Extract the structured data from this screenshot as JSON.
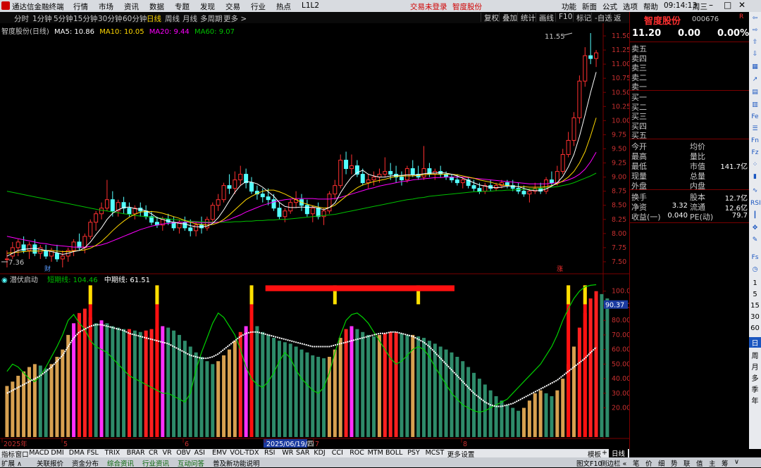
{
  "app_title": "通达信金融终端",
  "menu": [
    "行情",
    "市场",
    "资讯",
    "数据",
    "专题",
    "发现",
    "交易",
    "行业",
    "热点",
    "L1L2"
  ],
  "menu_red": [
    "交易未登录",
    "智度股份"
  ],
  "menu_right": [
    "功能",
    "新面",
    "公式",
    "选项",
    "帮助"
  ],
  "clock": "09:14:13",
  "weekday": "周三",
  "periods": [
    "分时",
    "1分钟",
    "5分钟",
    "15分钟",
    "30分钟",
    "60分钟",
    "日线",
    "周线",
    "月线",
    "多周期",
    "更多 >"
  ],
  "active_period": "日线",
  "toolbar_right": [
    "复权",
    "叠加",
    "统计",
    "画线",
    "F10",
    "标记",
    "-自选",
    "返回"
  ],
  "main_legend": {
    "name": "智度股份(日线)",
    "ma5": "MA5: 10.86",
    "ma10": "MA10: 10.05",
    "ma20": "MA20: 9.44",
    "ma60": "MA60: 9.07"
  },
  "sub_legend": {
    "name": "潜伏启动",
    "line1": "短期线: 104.46",
    "line2": "中期线: 61.51"
  },
  "price_axis": [
    "11.50",
    "11.25",
    "11.00",
    "10.75",
    "10.50",
    "10.25",
    "10.00",
    "9.75",
    "9.50",
    "9.25",
    "9.00",
    "8.75",
    "8.50",
    "8.25",
    "8.00",
    "7.75",
    "7.50"
  ],
  "sub_axis": [
    "100.0",
    "90.00",
    "80.00",
    "70.00",
    "60.00",
    "50.00",
    "40.00",
    "30.00",
    "20.00"
  ],
  "sub_current": "90.37",
  "price_high_label": "11.55",
  "price_low_label": "7.36",
  "event_marks": [
    "财",
    "涨"
  ],
  "date_axis": [
    "2025年",
    "5",
    "6",
    "2025/06/19/四",
    "7",
    "8"
  ],
  "period_label": "日线",
  "colors": {
    "up": "#ff3030",
    "down": "#54ffff",
    "ma5": "#ffffff",
    "ma10": "#ffd700",
    "ma20": "#ff00ff",
    "ma60": "#00c000"
  },
  "chart_data": {
    "type": "candlestick",
    "ylim": [
      7.3,
      11.6
    ],
    "candles": [
      [
        7.55,
        7.7,
        7.4,
        7.55
      ],
      [
        7.6,
        7.85,
        7.55,
        7.75
      ],
      [
        7.75,
        7.9,
        7.6,
        7.85
      ],
      [
        7.8,
        7.95,
        7.65,
        7.7
      ],
      [
        7.7,
        7.85,
        7.55,
        7.8
      ],
      [
        7.8,
        7.9,
        7.6,
        7.65
      ],
      [
        7.65,
        7.8,
        7.55,
        7.75
      ],
      [
        7.7,
        7.8,
        7.55,
        7.6
      ],
      [
        7.6,
        7.75,
        7.5,
        7.7
      ],
      [
        7.65,
        7.8,
        7.5,
        7.55
      ],
      [
        7.55,
        7.7,
        7.4,
        7.6
      ],
      [
        7.6,
        7.75,
        7.5,
        7.7
      ],
      [
        7.7,
        7.9,
        7.6,
        7.85
      ],
      [
        7.85,
        8.0,
        7.7,
        7.75
      ],
      [
        7.75,
        8.0,
        7.65,
        7.95
      ],
      [
        7.95,
        8.25,
        7.9,
        8.2
      ],
      [
        8.2,
        8.4,
        8.05,
        8.35
      ],
      [
        8.35,
        8.55,
        8.25,
        8.45
      ],
      [
        8.45,
        8.95,
        8.4,
        8.6
      ],
      [
        8.6,
        8.75,
        8.3,
        8.4
      ],
      [
        8.4,
        8.6,
        8.3,
        8.55
      ],
      [
        8.55,
        8.65,
        8.35,
        8.45
      ],
      [
        8.45,
        8.55,
        8.3,
        8.35
      ],
      [
        8.35,
        8.5,
        8.25,
        8.45
      ],
      [
        8.45,
        8.55,
        8.3,
        8.4
      ],
      [
        8.4,
        8.5,
        8.25,
        8.3
      ],
      [
        8.3,
        8.4,
        8.15,
        8.2
      ],
      [
        8.2,
        8.3,
        8.1,
        8.15
      ],
      [
        8.15,
        8.3,
        8.05,
        8.25
      ],
      [
        8.25,
        8.35,
        8.15,
        8.2
      ],
      [
        8.2,
        8.3,
        8.05,
        8.1
      ],
      [
        8.1,
        8.25,
        8.0,
        8.2
      ],
      [
        8.2,
        8.3,
        8.05,
        8.1
      ],
      [
        8.1,
        8.25,
        7.95,
        8.05
      ],
      [
        8.05,
        8.2,
        7.95,
        8.15
      ],
      [
        8.15,
        8.3,
        8.0,
        8.1
      ],
      [
        8.1,
        8.3,
        8.05,
        8.25
      ],
      [
        8.25,
        8.55,
        8.2,
        8.5
      ],
      [
        8.5,
        8.7,
        8.4,
        8.6
      ],
      [
        8.6,
        8.9,
        8.55,
        8.85
      ],
      [
        8.85,
        9.05,
        8.7,
        8.8
      ],
      [
        8.8,
        9.1,
        8.7,
        8.95
      ],
      [
        8.95,
        9.2,
        8.85,
        9.05
      ],
      [
        9.05,
        9.15,
        8.8,
        8.9
      ],
      [
        8.9,
        9.0,
        8.7,
        8.75
      ],
      [
        8.75,
        8.85,
        8.6,
        8.7
      ],
      [
        8.7,
        8.8,
        8.55,
        8.65
      ],
      [
        8.65,
        8.8,
        8.5,
        8.6
      ],
      [
        8.6,
        8.7,
        8.4,
        8.45
      ],
      [
        8.45,
        8.55,
        8.25,
        8.3
      ],
      [
        8.3,
        8.45,
        8.2,
        8.4
      ],
      [
        8.4,
        8.6,
        8.35,
        8.55
      ],
      [
        8.55,
        8.75,
        8.45,
        8.6
      ],
      [
        8.6,
        8.7,
        8.4,
        8.5
      ],
      [
        8.5,
        8.6,
        8.3,
        8.35
      ],
      [
        8.35,
        8.5,
        8.2,
        8.45
      ],
      [
        8.45,
        8.55,
        8.25,
        8.3
      ],
      [
        8.3,
        8.45,
        8.15,
        8.4
      ],
      [
        8.4,
        8.75,
        8.35,
        8.7
      ],
      [
        8.7,
        8.95,
        8.6,
        8.85
      ],
      [
        8.85,
        9.4,
        8.8,
        9.3
      ],
      [
        9.3,
        9.45,
        9.05,
        9.15
      ],
      [
        9.15,
        9.4,
        9.05,
        9.2
      ],
      [
        9.2,
        9.3,
        9.0,
        9.05
      ],
      [
        9.05,
        9.15,
        8.85,
        8.9
      ],
      [
        8.9,
        9.05,
        8.8,
        8.95
      ],
      [
        8.95,
        9.1,
        8.85,
        9.0
      ],
      [
        9.0,
        9.15,
        8.9,
        9.05
      ],
      [
        9.05,
        9.35,
        9.0,
        9.1
      ],
      [
        9.1,
        9.25,
        8.95,
        9.05
      ],
      [
        9.05,
        9.2,
        8.9,
        9.0
      ],
      [
        9.0,
        9.1,
        8.85,
        8.95
      ],
      [
        8.95,
        9.2,
        8.9,
        9.15
      ],
      [
        9.15,
        9.3,
        9.0,
        9.05
      ],
      [
        9.05,
        9.2,
        8.95,
        9.0
      ],
      [
        9.0,
        9.55,
        8.95,
        9.15
      ],
      [
        9.15,
        9.25,
        9.0,
        9.05
      ],
      [
        9.05,
        9.15,
        8.95,
        9.1
      ],
      [
        9.1,
        9.2,
        9.0,
        9.05
      ],
      [
        9.05,
        9.1,
        8.95,
        9.0
      ],
      [
        9.0,
        9.05,
        8.9,
        8.95
      ],
      [
        8.95,
        9.05,
        8.85,
        8.9
      ],
      [
        8.9,
        9.0,
        8.8,
        8.95
      ],
      [
        8.95,
        9.0,
        8.8,
        8.85
      ],
      [
        8.85,
        8.95,
        8.75,
        8.8
      ],
      [
        8.8,
        8.9,
        8.7,
        8.75
      ],
      [
        8.75,
        8.9,
        8.7,
        8.85
      ],
      [
        8.85,
        8.95,
        8.75,
        8.8
      ],
      [
        8.8,
        8.9,
        8.75,
        8.85
      ],
      [
        8.85,
        8.95,
        8.8,
        8.9
      ],
      [
        8.9,
        8.95,
        8.8,
        8.85
      ],
      [
        8.85,
        8.95,
        8.75,
        8.8
      ],
      [
        8.8,
        8.9,
        8.7,
        8.75
      ],
      [
        8.75,
        8.85,
        8.65,
        8.7
      ],
      [
        8.7,
        8.8,
        8.55,
        8.75
      ],
      [
        8.75,
        8.9,
        8.7,
        8.8
      ],
      [
        8.8,
        8.9,
        8.7,
        8.75
      ],
      [
        8.75,
        9.0,
        8.7,
        8.95
      ],
      [
        8.95,
        9.1,
        8.85,
        8.9
      ],
      [
        8.9,
        9.2,
        8.85,
        9.1
      ],
      [
        9.1,
        9.5,
        9.05,
        9.4
      ],
      [
        9.4,
        9.8,
        9.35,
        9.65
      ],
      [
        9.65,
        10.15,
        9.55,
        10.05
      ],
      [
        10.05,
        10.8,
        9.95,
        10.7
      ],
      [
        10.7,
        11.3,
        10.6,
        11.15
      ],
      [
        11.15,
        11.55,
        11.0,
        11.1
      ],
      [
        11.1,
        11.25,
        10.95,
        11.2
      ]
    ],
    "ma5": [
      7.6,
      7.65,
      7.7,
      7.72,
      7.73,
      7.74,
      7.72,
      7.7,
      7.68,
      7.66,
      7.63,
      7.65,
      7.68,
      7.7,
      7.75,
      7.85,
      7.98,
      8.1,
      8.25,
      8.36,
      8.42,
      8.46,
      8.47,
      8.44,
      8.43,
      8.4,
      8.35,
      8.28,
      8.25,
      8.22,
      8.2,
      8.18,
      8.17,
      8.14,
      8.12,
      8.12,
      8.13,
      8.18,
      8.28,
      8.42,
      8.58,
      8.73,
      8.85,
      8.92,
      8.91,
      8.88,
      8.82,
      8.74,
      8.66,
      8.55,
      8.48,
      8.46,
      8.46,
      8.47,
      8.46,
      8.47,
      8.45,
      8.42,
      8.46,
      8.54,
      8.72,
      8.87,
      9.0,
      9.08,
      9.12,
      9.05,
      9.02,
      9.0,
      9.0,
      9.02,
      9.03,
      9.03,
      9.04,
      9.04,
      9.04,
      9.06,
      9.07,
      9.07,
      9.08,
      9.07,
      9.05,
      9.02,
      8.98,
      8.94,
      8.9,
      8.86,
      8.84,
      8.82,
      8.81,
      8.82,
      8.84,
      8.84,
      8.83,
      8.8,
      8.77,
      8.76,
      8.76,
      8.79,
      8.84,
      8.9,
      9.01,
      9.18,
      9.4,
      9.72,
      10.1,
      10.5,
      10.86
    ],
    "ma10": [
      7.65,
      7.66,
      7.67,
      7.68,
      7.69,
      7.69,
      7.69,
      7.7,
      7.7,
      7.69,
      7.68,
      7.68,
      7.69,
      7.7,
      7.71,
      7.74,
      7.79,
      7.86,
      7.95,
      8.05,
      8.14,
      8.22,
      8.29,
      8.34,
      8.38,
      8.39,
      8.39,
      8.38,
      8.36,
      8.33,
      8.3,
      8.27,
      8.23,
      8.2,
      8.17,
      8.16,
      8.15,
      8.16,
      8.19,
      8.25,
      8.33,
      8.42,
      8.51,
      8.6,
      8.66,
      8.71,
      8.75,
      8.77,
      8.77,
      8.74,
      8.7,
      8.65,
      8.6,
      8.55,
      8.52,
      8.49,
      8.47,
      8.45,
      8.46,
      8.5,
      8.58,
      8.66,
      8.74,
      8.81,
      8.86,
      8.89,
      8.92,
      8.94,
      8.96,
      8.99,
      9.01,
      9.02,
      9.02,
      9.02,
      9.03,
      9.04,
      9.05,
      9.05,
      9.05,
      9.05,
      9.05,
      9.04,
      9.02,
      9.0,
      8.98,
      8.95,
      8.93,
      8.91,
      8.88,
      8.86,
      8.85,
      8.84,
      8.83,
      8.83,
      8.82,
      8.82,
      8.82,
      8.83,
      8.85,
      8.88,
      8.93,
      9.0,
      9.1,
      9.25,
      9.45,
      9.73,
      10.05
    ],
    "ma20": [
      7.95,
      7.93,
      7.91,
      7.89,
      7.87,
      7.85,
      7.83,
      7.82,
      7.8,
      7.79,
      7.78,
      7.77,
      7.76,
      7.76,
      7.76,
      7.77,
      7.78,
      7.8,
      7.83,
      7.87,
      7.91,
      7.95,
      7.99,
      8.03,
      8.07,
      8.1,
      8.13,
      8.15,
      8.17,
      8.18,
      8.19,
      8.2,
      8.2,
      8.2,
      8.2,
      8.19,
      8.19,
      8.19,
      8.2,
      8.22,
      8.25,
      8.29,
      8.33,
      8.38,
      8.42,
      8.46,
      8.5,
      8.53,
      8.56,
      8.58,
      8.6,
      8.61,
      8.62,
      8.62,
      8.62,
      8.62,
      8.61,
      8.61,
      8.61,
      8.62,
      8.64,
      8.67,
      8.7,
      8.73,
      8.76,
      8.79,
      8.81,
      8.84,
      8.86,
      8.88,
      8.9,
      8.92,
      8.93,
      8.95,
      8.96,
      8.97,
      8.98,
      8.99,
      8.99,
      9.0,
      9.0,
      9.0,
      9.0,
      8.99,
      8.98,
      8.97,
      8.96,
      8.95,
      8.94,
      8.93,
      8.92,
      8.91,
      8.9,
      8.89,
      8.88,
      8.88,
      8.88,
      8.88,
      8.89,
      8.9,
      8.92,
      8.95,
      8.99,
      9.05,
      9.14,
      9.27,
      9.44
    ],
    "ma60": [
      8.75,
      8.73,
      8.71,
      8.69,
      8.67,
      8.65,
      8.63,
      8.61,
      8.59,
      8.57,
      8.55,
      8.53,
      8.51,
      8.49,
      8.47,
      8.45,
      8.43,
      8.41,
      8.4,
      8.38,
      8.37,
      8.35,
      8.34,
      8.32,
      8.31,
      8.3,
      8.29,
      8.28,
      8.27,
      8.26,
      8.25,
      8.24,
      8.23,
      8.22,
      8.21,
      8.21,
      8.2,
      8.2,
      8.2,
      8.2,
      8.2,
      8.21,
      8.21,
      8.22,
      8.22,
      8.23,
      8.23,
      8.24,
      8.24,
      8.25,
      8.25,
      8.26,
      8.27,
      8.28,
      8.29,
      8.3,
      8.31,
      8.32,
      8.33,
      8.34,
      8.36,
      8.38,
      8.4,
      8.42,
      8.44,
      8.46,
      8.48,
      8.5,
      8.52,
      8.54,
      8.56,
      8.58,
      8.6,
      8.61,
      8.63,
      8.64,
      8.66,
      8.67,
      8.68,
      8.69,
      8.7,
      8.71,
      8.72,
      8.73,
      8.74,
      8.74,
      8.75,
      8.75,
      8.76,
      8.76,
      8.77,
      8.77,
      8.78,
      8.78,
      8.79,
      8.79,
      8.8,
      8.81,
      8.82,
      8.83,
      8.85,
      8.87,
      8.9,
      8.94,
      8.98,
      9.02,
      9.07
    ],
    "sub_ylim": [
      0,
      110
    ],
    "sub_bars": [
      35,
      38,
      42,
      45,
      48,
      50,
      49,
      47,
      50,
      55,
      60,
      70,
      78,
      85,
      88,
      82,
      78,
      80,
      78,
      76,
      75,
      74,
      74,
      73,
      72,
      73,
      74,
      75,
      76,
      75,
      73,
      70,
      66,
      62,
      58,
      55,
      52,
      50,
      52,
      56,
      60,
      66,
      72,
      76,
      78,
      76,
      72,
      70,
      68,
      66,
      65,
      64,
      62,
      60,
      58,
      56,
      55,
      54,
      55,
      60,
      68,
      74,
      76,
      74,
      72,
      70,
      69,
      70,
      71,
      72,
      72,
      71,
      70,
      70,
      69,
      68,
      66,
      64,
      62,
      60,
      58,
      55,
      52,
      48,
      44,
      40,
      36,
      32,
      28,
      25,
      22,
      20,
      18,
      20,
      25,
      30,
      32,
      30,
      28,
      32,
      40,
      50,
      62,
      75,
      85,
      95,
      100,
      98,
      95
    ],
    "sub_short": [
      45,
      50,
      48,
      44,
      40,
      38,
      42,
      48,
      55,
      62,
      70,
      80,
      84,
      78,
      74,
      66,
      62,
      60,
      58,
      54,
      50,
      46,
      42,
      40,
      38,
      36,
      34,
      32,
      30,
      30,
      28,
      26,
      24,
      30,
      46,
      58,
      68,
      78,
      85,
      82,
      76,
      70,
      60,
      48,
      40,
      36,
      34,
      38,
      44,
      52,
      58,
      54,
      46,
      40,
      36,
      32,
      30,
      34,
      44,
      58,
      70,
      80,
      84,
      85,
      82,
      78,
      72,
      66,
      60,
      54,
      50,
      52,
      56,
      60,
      62,
      60,
      55,
      48,
      42,
      36,
      30,
      26,
      22,
      20,
      18,
      17,
      18,
      20,
      22,
      24,
      26,
      30,
      34,
      38,
      42,
      46,
      50,
      56,
      62,
      70,
      80,
      88,
      95,
      100,
      103,
      104,
      104.46
    ],
    "sub_mid": [
      30,
      32,
      34,
      36,
      38,
      40,
      42,
      45,
      48,
      52,
      56,
      62,
      68,
      72,
      74,
      76,
      77,
      77,
      76,
      75,
      74,
      73,
      71,
      70,
      69,
      68,
      67,
      66,
      65,
      64,
      62,
      60,
      58,
      56,
      55,
      54,
      54,
      55,
      57,
      60,
      63,
      66,
      69,
      71,
      72,
      72,
      71,
      70,
      69,
      68,
      67,
      66,
      65,
      64,
      63,
      62,
      62,
      62,
      62,
      63,
      64,
      65,
      66,
      67,
      68,
      69,
      70,
      71,
      71,
      72,
      72,
      71,
      70,
      69,
      67,
      65,
      62,
      58,
      54,
      50,
      46,
      42,
      38,
      34,
      30,
      27,
      24,
      22,
      21,
      21,
      22,
      23,
      25,
      27,
      29,
      31,
      33,
      35,
      37,
      39,
      42,
      45,
      48,
      51,
      54,
      58,
      61.51
    ]
  },
  "quote": {
    "name": "智度股份",
    "code": "000676",
    "flag": "R",
    "price": "11.20",
    "change": "0.00",
    "pct": "0.00%",
    "sell_labels": [
      "卖五",
      "卖四",
      "卖三",
      "卖二",
      "卖一"
    ],
    "buy_labels": [
      "买一",
      "买二",
      "买三",
      "买四",
      "买五"
    ],
    "stats_left": [
      "今开",
      "最高",
      "最低",
      "现量",
      "外盘"
    ],
    "stats_mid": [
      "均价",
      "量比",
      "市值",
      "总量",
      "内盘"
    ],
    "market_cap": "141.7亿",
    "fund_left": [
      "换手",
      "净资",
      "收益(一)"
    ],
    "fund_left_val": [
      "",
      "3.32",
      "0.040"
    ],
    "fund_mid": [
      "股本",
      "流通",
      "PE(动)"
    ],
    "fund_mid_val": [
      "12.7亿",
      "12.6亿",
      "79.7"
    ]
  },
  "side_tools": [
    "日",
    "周",
    "月",
    "多",
    "季",
    "年"
  ],
  "side_nums": [
    "1",
    "5",
    "15",
    "30",
    "60"
  ],
  "indicators": [
    "指标",
    "窗口",
    "MACD",
    "DMI",
    "DMA",
    "FSL",
    "TRIX",
    "BRAR",
    "CR",
    "VR",
    "OBV",
    "ASI",
    "EMV",
    "VOL-TDX",
    "RSI",
    "WR",
    "SAR",
    "KDJ",
    "CCI",
    "ROC",
    "MTM",
    "BOLL",
    "PSY",
    "MCST",
    "更多",
    "设置"
  ],
  "indicator_right": [
    "模板",
    "+",
    "<"
  ],
  "status_tabs": [
    "扩展 ∧",
    "关联报价",
    "资金分布",
    "综合资讯",
    "行业资讯",
    "互动问答",
    "普及新功能说明"
  ],
  "status_right": [
    "图文F10",
    "侧边栏 «",
    "笔",
    "价",
    "细",
    "势",
    "联",
    "值",
    "主",
    "筹",
    "∨"
  ]
}
